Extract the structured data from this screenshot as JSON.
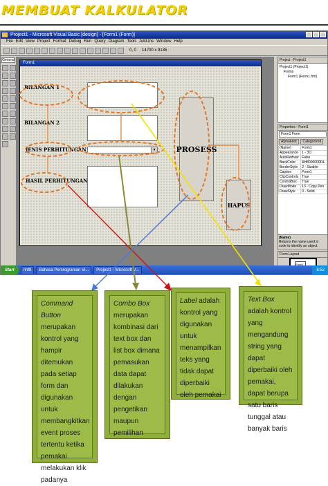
{
  "page_title": "MEMBUAT KALKULATOR",
  "ide": {
    "title": "Project1 - Microsoft Visual Basic [design] - [Form1 (Form)]",
    "menu": [
      "File",
      "Edit",
      "View",
      "Project",
      "Format",
      "Debug",
      "Run",
      "Query",
      "Diagram",
      "Tools",
      "Add-Ins",
      "Window",
      "Help"
    ],
    "toolbar_pos": "0, 0",
    "toolbar_size": "14700 x 9135",
    "toolbox_header": "General",
    "form_title": "Form1"
  },
  "form": {
    "label_bilangan1": "BILANGAN 1",
    "label_bilangan2": "BILANGAN 2",
    "label_jenis": "JENIS PERHITUNGAN",
    "label_hasil": "HASIL PERHITUNGAN",
    "btn_proses": "PROSESS",
    "btn_hapus": "HAPUS"
  },
  "project_panel": {
    "title": "Project - Project1",
    "node_project": "Project1 (Project1)",
    "node_forms": "Forms",
    "node_form1": "Form1 (Form1.frm)"
  },
  "properties": {
    "title": "Properties - Form1",
    "object": "Form1  Form",
    "tab_alpha": "Alphabetic",
    "tab_cat": "Categorized",
    "rows": [
      [
        "(Name)",
        "Form1"
      ],
      [
        "Appearance",
        "1 - 3D"
      ],
      [
        "AutoRedraw",
        "False"
      ],
      [
        "BackColor",
        "&H8000000F&"
      ],
      [
        "BorderStyle",
        "2 - Sizable"
      ],
      [
        "Caption",
        "Form1"
      ],
      [
        "ClipControls",
        "True"
      ],
      [
        "ControlBox",
        "True"
      ],
      [
        "DrawMode",
        "13 - Copy Pen"
      ],
      [
        "DrawStyle",
        "0 - Solid"
      ]
    ],
    "desc_title": "(Name)",
    "desc_text": "Returns the name used in code to identify an object."
  },
  "form_layout": {
    "title": "Form Layout",
    "mini": "Form1"
  },
  "taskbar": {
    "start": "Start",
    "tasks": [
      "rinf8",
      "Bahasa Pemrograman Vi...",
      "Project1 - Microsoft V..."
    ],
    "clock": "8:52"
  },
  "callouts": {
    "command": {
      "term": "Command Button",
      "text": "merupakan kontrol yang hampir ditemukan pada setiap form dan digunakan untuk membangkitkan event proses tertentu ketika pemakai melakukan klik padanya"
    },
    "combo": {
      "term": "Combo Box",
      "text": "merupakan kombinasi dari text box dan list box dimana pemasukan data dapat dilakukan dengan pengetikan maupun pemilihan"
    },
    "label": {
      "term": "Label",
      "text": "adalah kontrol yang digunakan untuk menampilkan teks yang tidak dapat diperbaiki oleh pemakai"
    },
    "textbox": {
      "term": "Text Box",
      "text": "adalah kontrol yang mengandung string yang dapat diperbaiki oleh pemakai, dapat berupa satu baris tunggal atau banyak baris"
    }
  },
  "colors": {
    "title": "#f0d000",
    "callout_bg": "#9cbb48",
    "ellipse": "#e07a2a",
    "arrow_yellow": "#f2e200",
    "arrow_olive": "#8a8a3a",
    "arrow_red": "#d01010",
    "arrow_blue": "#4a7ad8"
  }
}
